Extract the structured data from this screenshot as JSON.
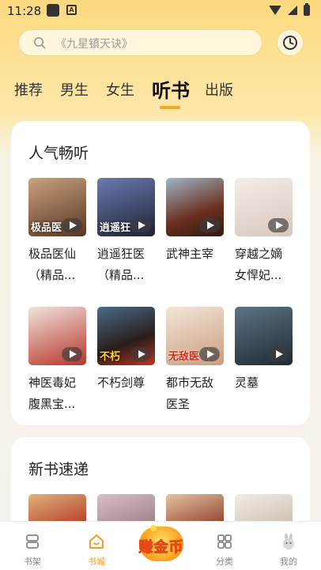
{
  "status_bar": {
    "time": "11:28"
  },
  "search": {
    "placeholder": "《九星镇天诀》"
  },
  "tabs": [
    {
      "label": "推荐",
      "active": false
    },
    {
      "label": "男生",
      "active": false
    },
    {
      "label": "女生",
      "active": false
    },
    {
      "label": "听书",
      "active": true
    },
    {
      "label": "出版",
      "active": false
    }
  ],
  "popular": {
    "title": "人气畅听",
    "books": [
      {
        "title": "极品医仙（精品...",
        "cover_text": "极品医",
        "color": "#8a5a3a"
      },
      {
        "title": "逍遥狂医（精品...",
        "cover_text": "逍遥狂",
        "color": "#2f3450"
      },
      {
        "title": "武神主宰",
        "cover_text": "",
        "color": "#5c3c2a"
      },
      {
        "title": "穿越之嫡女悍妃...",
        "cover_text": "",
        "color": "#e7dcd6"
      },
      {
        "title": "神医毒妃腹黑宝...",
        "cover_text": "",
        "color": "#c9473a"
      },
      {
        "title": "不朽剑尊",
        "cover_text": "不朽",
        "color": "#3b2b2a"
      },
      {
        "title": "都市无敌医圣",
        "cover_text": "无敌医",
        "color": "#d9b9a0"
      },
      {
        "title": "灵墓",
        "cover_text": "",
        "color": "#2b3944"
      }
    ]
  },
  "new_books": {
    "title": "新书速递",
    "colors": [
      "#b43a2a",
      "#9d7f86",
      "#8d3f2a",
      "#cdbfb1"
    ]
  },
  "bottom_nav": {
    "items": [
      {
        "label": "书架",
        "active": false
      },
      {
        "label": "书城",
        "active": true
      },
      {
        "label": "赚金币",
        "active": false
      },
      {
        "label": "分类",
        "active": false
      },
      {
        "label": "我的",
        "active": false
      }
    ]
  },
  "colors": {
    "accent": "#f5a623",
    "active_nav": "#f59a23"
  }
}
